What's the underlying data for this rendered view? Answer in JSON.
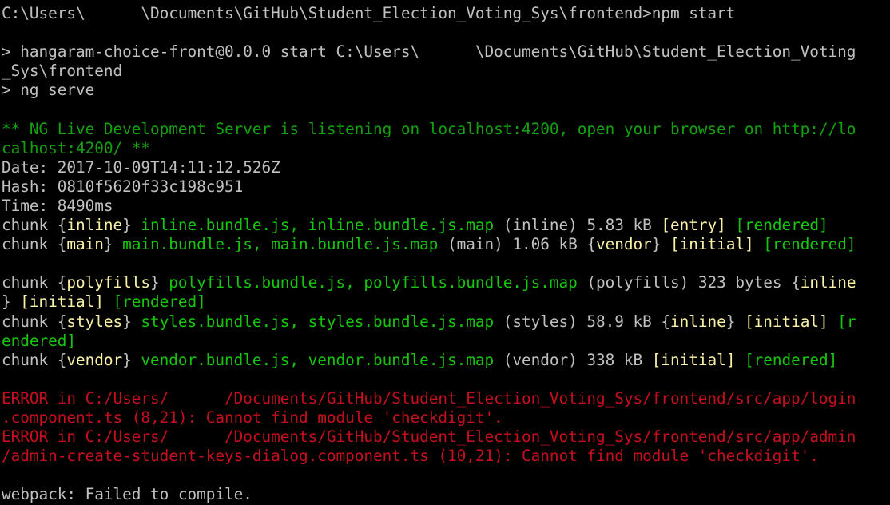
{
  "window": {
    "background": "#000000"
  },
  "colors": {
    "default_text": "#c0c0c0",
    "ng_notice": "#13a10e",
    "file_names": "#16c60c",
    "flags": "#f9f1a5",
    "error": "#c50f1f"
  },
  "lines": [
    [
      {
        "text": "C:\\Users\\      \\Documents\\GitHub\\Student_Election_Voting_Sys\\frontend>npm start",
        "color": "gray"
      }
    ],
    [
      {
        "text": "",
        "color": "gray"
      }
    ],
    [
      {
        "text": "> hangaram-choice-front@0.0.0 start C:\\Users\\      \\Documents\\GitHub\\Student_Election_Voting",
        "color": "gray"
      }
    ],
    [
      {
        "text": "_Sys\\frontend",
        "color": "gray"
      }
    ],
    [
      {
        "text": "> ng serve",
        "color": "gray"
      }
    ],
    [
      {
        "text": "",
        "color": "gray"
      }
    ],
    [
      {
        "text": "** NG Live Development Server is listening on localhost:4200, open your browser on http://lo",
        "color": "green"
      }
    ],
    [
      {
        "text": "calhost:4200/ **",
        "color": "green"
      }
    ],
    [
      {
        "text": "Date: 2017-10-09T14:11:12.526Z",
        "color": "gray"
      }
    ],
    [
      {
        "text": "Hash: 0810f5620f33c198c951",
        "color": "gray"
      }
    ],
    [
      {
        "text": "Time: 8490ms",
        "color": "gray"
      }
    ],
    [
      {
        "text": "chunk {",
        "color": "gray"
      },
      {
        "text": "inline",
        "color": "yellow"
      },
      {
        "text": "} ",
        "color": "gray"
      },
      {
        "text": "inline.bundle.js, inline.bundle.js.map",
        "color": "bgreen"
      },
      {
        "text": " (inline) 5.83 kB ",
        "color": "gray"
      },
      {
        "text": "[entry]",
        "color": "yellow"
      },
      {
        "text": " ",
        "color": "gray"
      },
      {
        "text": "[rendered]",
        "color": "bgreen"
      }
    ],
    [
      {
        "text": "chunk {",
        "color": "gray"
      },
      {
        "text": "main",
        "color": "yellow"
      },
      {
        "text": "} ",
        "color": "gray"
      },
      {
        "text": "main.bundle.js, main.bundle.js.map",
        "color": "bgreen"
      },
      {
        "text": " (main) 1.06 kB {",
        "color": "gray"
      },
      {
        "text": "vendor",
        "color": "yellow"
      },
      {
        "text": "} ",
        "color": "gray"
      },
      {
        "text": "[initial]",
        "color": "yellow"
      },
      {
        "text": " ",
        "color": "gray"
      },
      {
        "text": "[rendered]",
        "color": "bgreen"
      }
    ],
    [
      {
        "text": "",
        "color": "gray"
      }
    ],
    [
      {
        "text": "chunk {",
        "color": "gray"
      },
      {
        "text": "polyfills",
        "color": "yellow"
      },
      {
        "text": "} ",
        "color": "gray"
      },
      {
        "text": "polyfills.bundle.js, polyfills.bundle.js.map",
        "color": "bgreen"
      },
      {
        "text": " (polyfills) 323 bytes {",
        "color": "gray"
      },
      {
        "text": "inline",
        "color": "yellow"
      }
    ],
    [
      {
        "text": "} ",
        "color": "gray"
      },
      {
        "text": "[initial]",
        "color": "yellow"
      },
      {
        "text": " ",
        "color": "gray"
      },
      {
        "text": "[rendered]",
        "color": "bgreen"
      }
    ],
    [
      {
        "text": "chunk {",
        "color": "gray"
      },
      {
        "text": "styles",
        "color": "yellow"
      },
      {
        "text": "} ",
        "color": "gray"
      },
      {
        "text": "styles.bundle.js, styles.bundle.js.map",
        "color": "bgreen"
      },
      {
        "text": " (styles) 58.9 kB {",
        "color": "gray"
      },
      {
        "text": "inline",
        "color": "yellow"
      },
      {
        "text": "} ",
        "color": "gray"
      },
      {
        "text": "[initial]",
        "color": "yellow"
      },
      {
        "text": " ",
        "color": "gray"
      },
      {
        "text": "[r",
        "color": "bgreen"
      }
    ],
    [
      {
        "text": "endered]",
        "color": "bgreen"
      }
    ],
    [
      {
        "text": "chunk {",
        "color": "gray"
      },
      {
        "text": "vendor",
        "color": "yellow"
      },
      {
        "text": "} ",
        "color": "gray"
      },
      {
        "text": "vendor.bundle.js, vendor.bundle.js.map",
        "color": "bgreen"
      },
      {
        "text": " (vendor) 338 kB ",
        "color": "gray"
      },
      {
        "text": "[initial]",
        "color": "yellow"
      },
      {
        "text": " ",
        "color": "gray"
      },
      {
        "text": "[rendered]",
        "color": "bgreen"
      }
    ],
    [
      {
        "text": "",
        "color": "gray"
      }
    ],
    [
      {
        "text": "ERROR in C:/Users/      /Documents/GitHub/Student_Election_Voting_Sys/frontend/src/app/login",
        "color": "red"
      }
    ],
    [
      {
        "text": ".component.ts (8,21): Cannot find module 'checkdigit'.",
        "color": "red"
      }
    ],
    [
      {
        "text": "ERROR in C:/Users/      /Documents/GitHub/Student_Election_Voting_Sys/frontend/src/app/admin",
        "color": "red"
      }
    ],
    [
      {
        "text": "/admin-create-student-keys-dialog.component.ts (10,21): Cannot find module 'checkdigit'.",
        "color": "red"
      }
    ],
    [
      {
        "text": "",
        "color": "gray"
      }
    ],
    [
      {
        "text": "webpack: Failed to compile.",
        "color": "gray"
      }
    ]
  ]
}
